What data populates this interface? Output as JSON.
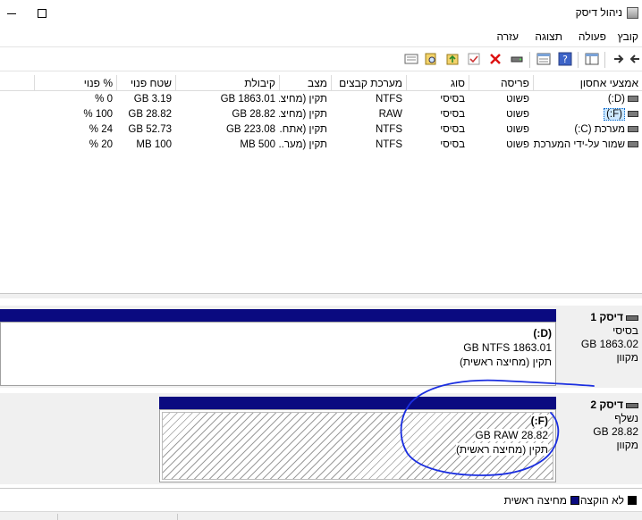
{
  "window": {
    "title": "ניהול דיסק",
    "minimize_icon": "minimize-icon",
    "maximize_icon": "maximize-icon"
  },
  "menu": [
    "קובץ",
    "פעולה",
    "תצוגה",
    "עזרה"
  ],
  "toolbar": {
    "icons": [
      "back-arrow-icon",
      "forward-arrow-icon",
      "console-tree-icon",
      "help-icon",
      "properties-icon",
      "connect-disk-icon",
      "check-icon",
      "delete-icon",
      "export-icon",
      "search-icon",
      "settings-icon"
    ]
  },
  "volume_list": {
    "columns": [
      "אמצעי אחסון",
      "פריסה",
      "סוג",
      "מערכת קבצים",
      "מצב",
      "קיבולת",
      "שטח פנוי",
      "% פנוי"
    ],
    "rows": [
      [
        "(D:)",
        "פשוט",
        "בסיסי",
        "NTFS",
        "תקין (מחיצ...",
        "1863.01 GB",
        "3.19 GB",
        "0 %"
      ],
      [
        "(F:)",
        "פשוט",
        "בסיסי",
        "RAW",
        "תקין (מחיצ...",
        "28.82 GB",
        "28.82 GB",
        "100 %"
      ],
      [
        "מערכת (C:)",
        "פשוט",
        "בסיסי",
        "NTFS",
        "תקין (אתח...",
        "223.08 GB",
        "52.73 GB",
        "24 %"
      ],
      [
        "שמור על-ידי המערכת",
        "פשוט",
        "בסיסי",
        "NTFS",
        "תקין (מער...",
        "500 MB",
        "100 MB",
        "20 %"
      ]
    ],
    "selected_row": 1
  },
  "disks": [
    {
      "title": "דיסק 1",
      "type": "בסיסי",
      "size": "1863.02 GB",
      "status": "מקוון",
      "partition": {
        "name": "(D:)",
        "info": "1863.01 GB NTFS",
        "status": "תקין (מחיצה ראשית)"
      }
    },
    {
      "title": "דיסק 2",
      "type": "נשלף",
      "size": "28.82 GB",
      "status": "מקוון",
      "partition": {
        "name": "(F:)",
        "info": "28.82 GB RAW",
        "status": "תקין (מחיצה ראשית)"
      }
    }
  ],
  "legend": [
    {
      "label": "לא הוקצה",
      "color": "#000000"
    },
    {
      "label": "מחיצה ראשית",
      "color": "#0a0a80"
    }
  ],
  "colors": {
    "primary_partition": "#0a0a80",
    "unallocated": "#000000",
    "annotation": "#1a2ee0"
  }
}
